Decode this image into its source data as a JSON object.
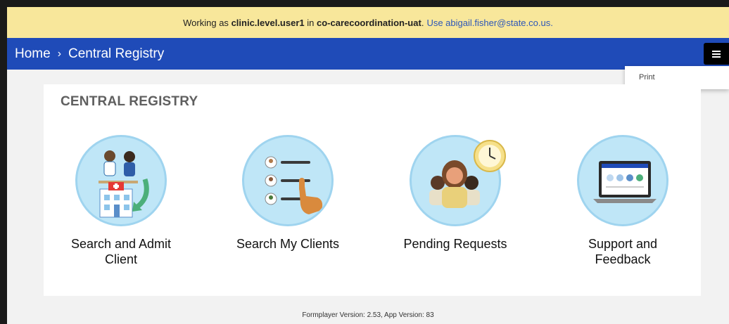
{
  "banner": {
    "prefix": "Working as",
    "user": "clinic.level.user1",
    "mid": "in",
    "domain": "co-carecoordination-uat",
    "link": "Use abigail.fisher@state.co.us."
  },
  "nav": {
    "home": "Home",
    "separator": "›",
    "current": "Central Registry",
    "menu_icon": "hamburger-icon"
  },
  "dropdown": {
    "print": "Print"
  },
  "card": {
    "title": "CENTRAL REGISTRY",
    "tiles": [
      {
        "label": "Search and Admit Client",
        "icon": "admit-client-icon"
      },
      {
        "label": "Search My Clients",
        "icon": "search-clients-icon"
      },
      {
        "label": "Pending Requests",
        "icon": "pending-requests-icon"
      },
      {
        "label": "Support and Feedback",
        "icon": "support-feedback-icon"
      }
    ]
  },
  "footer": "Formplayer Version: 2.53, App Version: 83",
  "colors": {
    "banner": "#f8e79b",
    "navbar": "#1f4bb8",
    "circle": "#bfe6f7",
    "link": "#2c56b8"
  }
}
